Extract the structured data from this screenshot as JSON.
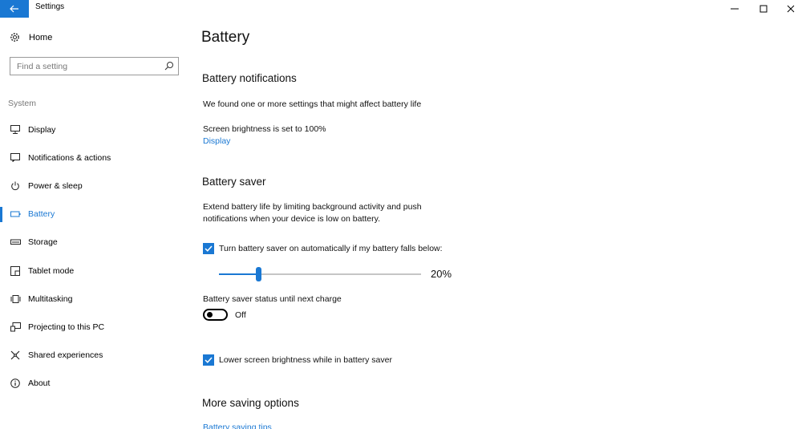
{
  "window": {
    "title": "Settings",
    "back_icon": "back-arrow-icon",
    "controls": [
      "minimize-icon",
      "maximize-icon",
      "close-icon"
    ]
  },
  "sidebar": {
    "home_label": "Home",
    "search_placeholder": "Find a setting",
    "section_label": "System",
    "items": [
      {
        "label": "Display",
        "icon": "monitor-icon"
      },
      {
        "label": "Notifications & actions",
        "icon": "notifications-icon"
      },
      {
        "label": "Power & sleep",
        "icon": "power-icon"
      },
      {
        "label": "Battery",
        "icon": "battery-icon",
        "active": true
      },
      {
        "label": "Storage",
        "icon": "storage-icon"
      },
      {
        "label": "Tablet mode",
        "icon": "tablet-icon"
      },
      {
        "label": "Multitasking",
        "icon": "multitasking-icon"
      },
      {
        "label": "Projecting to this PC",
        "icon": "projecting-icon"
      },
      {
        "label": "Shared experiences",
        "icon": "shared-experiences-icon"
      },
      {
        "label": "About",
        "icon": "info-icon"
      }
    ],
    "accent_color": "#1a78d3"
  },
  "main": {
    "title": "Battery",
    "notifications": {
      "heading": "Battery notifications",
      "description": "We found one or more settings that might affect battery life",
      "brightness_text": "Screen brightness is set to 100%",
      "display_link": "Display"
    },
    "saver": {
      "heading": "Battery saver",
      "description_line1": "Extend battery life by limiting background activity and push",
      "description_line2": "notifications when your device is low on battery.",
      "auto_checkbox_label": "Turn battery saver on automatically if my battery falls below:",
      "auto_checked": true,
      "threshold_value": "20%",
      "threshold_fraction": 0.2,
      "status_label": "Battery saver status until next charge",
      "status_toggle": "Off",
      "brightness_checkbox_label": "Lower screen brightness while in battery saver",
      "brightness_checked": true
    },
    "more": {
      "heading": "More saving options",
      "tips_link": "Battery saving tips"
    }
  }
}
